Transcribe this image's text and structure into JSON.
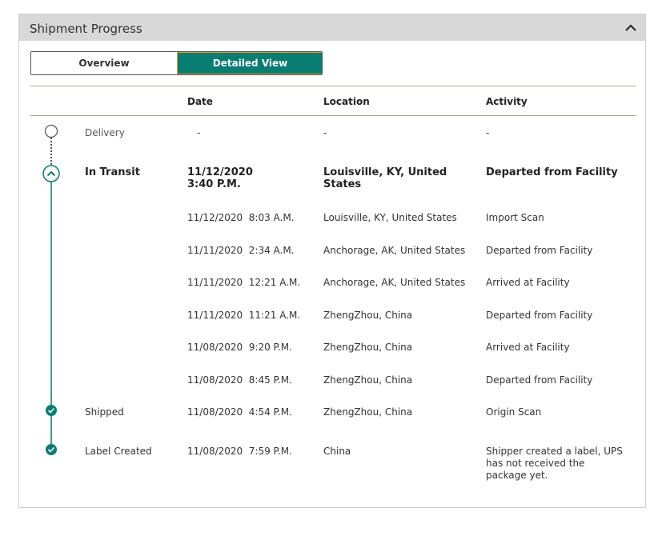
{
  "panel": {
    "title": "Shipment Progress",
    "collapse_icon": "chevron-up-icon"
  },
  "view_toggle": {
    "overview_label": "Overview",
    "detailed_label": "Detailed View",
    "active": "Detailed View"
  },
  "columns": {
    "date": "Date",
    "location": "Location",
    "activity": "Activity"
  },
  "rows": [
    {
      "status": "Delivery",
      "date": "-",
      "location": "-",
      "activity": "-"
    },
    {
      "status": "In Transit",
      "date": "11/12/2020\n3:40 P.M.",
      "location": "Louisville, KY, United States",
      "activity": "Departed from Facility"
    },
    {
      "status": "",
      "date": "11/12/2020  8:03 A.M.",
      "location": "Louisville, KY, United States",
      "activity": "Import Scan"
    },
    {
      "status": "",
      "date": "11/11/2020  2:34 A.M.",
      "location": "Anchorage, AK, United States",
      "activity": "Departed from Facility"
    },
    {
      "status": "",
      "date": "11/11/2020  12:21 A.M.",
      "location": "Anchorage, AK, United States",
      "activity": "Arrived at Facility"
    },
    {
      "status": "",
      "date": "11/11/2020  11:21 A.M.",
      "location": "ZhengZhou, China",
      "activity": "Departed from Facility"
    },
    {
      "status": "",
      "date": "11/08/2020  9:20 P.M.",
      "location": "ZhengZhou, China",
      "activity": "Arrived at Facility"
    },
    {
      "status": "",
      "date": "11/08/2020  8:45 P.M.",
      "location": "ZhengZhou, China",
      "activity": "Departed from Facility"
    },
    {
      "status": "Shipped",
      "date": "11/08/2020  4:54 P.M.",
      "location": "ZhengZhou, China",
      "activity": "Origin Scan"
    },
    {
      "status": "Label Created",
      "date": "11/08/2020  7:59 P.M.",
      "location": "China",
      "activity": "Shipper created a label, UPS has not received the package yet."
    }
  ],
  "colors": {
    "accent": "#0a7d72",
    "header_bg": "#d8d8d8",
    "rule": "#b6a594"
  }
}
